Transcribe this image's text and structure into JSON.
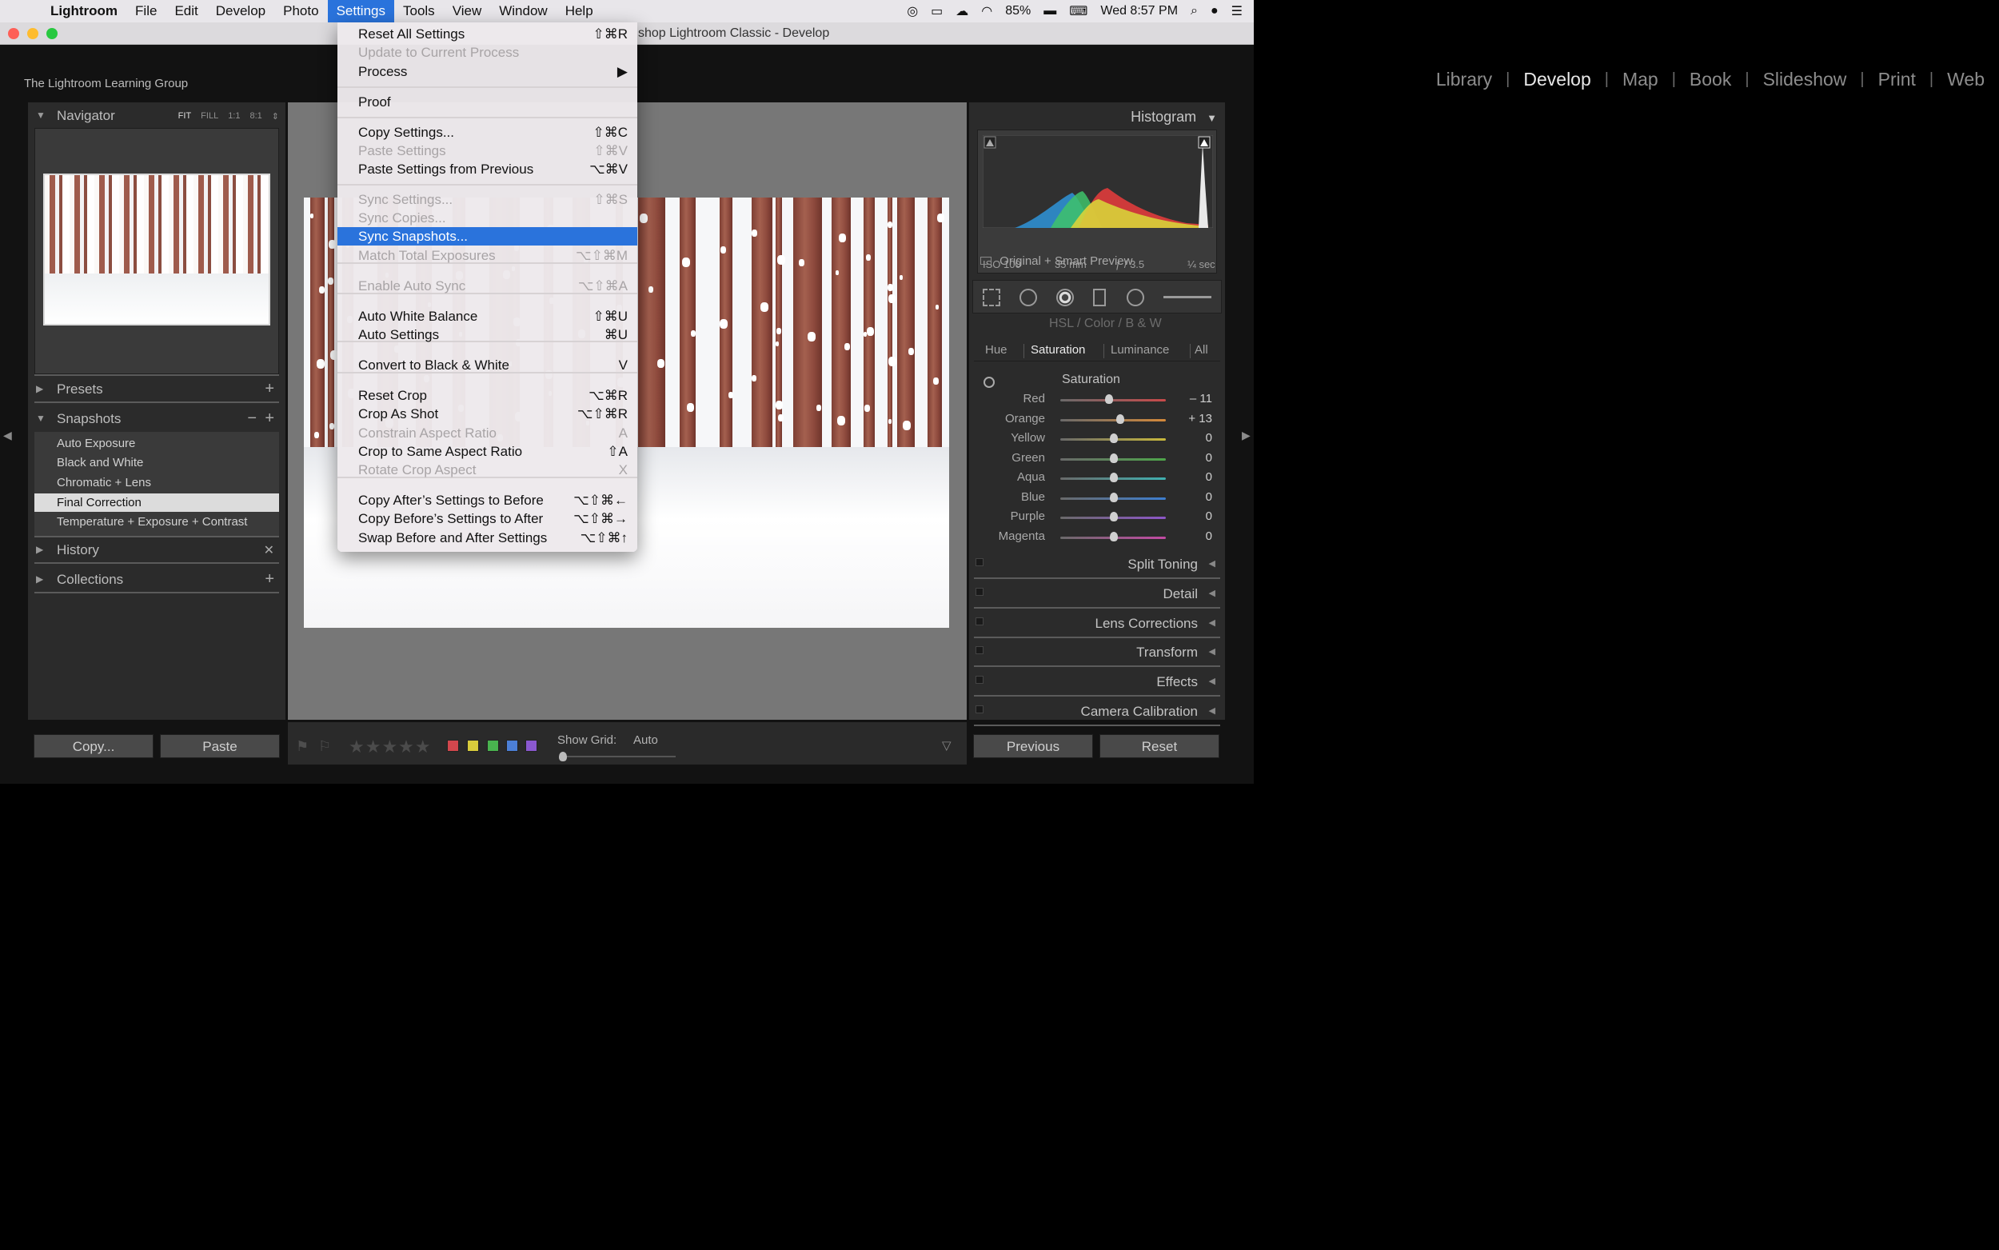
{
  "menubar": {
    "apple": "",
    "items": [
      "Lightroom",
      "File",
      "Edit",
      "Develop",
      "Photo",
      "Settings",
      "Tools",
      "View",
      "Window",
      "Help"
    ],
    "battery": "85%",
    "clock": "Wed 8:57 PM"
  },
  "window": {
    "title": "shop Lightroom Classic - Develop"
  },
  "identity": "The Lightroom Learning Group",
  "modules": [
    "Library",
    "Develop",
    "Map",
    "Book",
    "Slideshow",
    "Print",
    "Web"
  ],
  "left": {
    "navigator": {
      "title": "Navigator",
      "zoom": [
        "FIT",
        "FILL",
        "1:1",
        "8:1"
      ]
    },
    "presets": {
      "title": "Presets"
    },
    "snapshots": {
      "title": "Snapshots",
      "items": [
        "Auto Exposure",
        "Black and White",
        "Chromatic + Lens",
        "Final Correction",
        "Temperature + Exposure + Contrast"
      ],
      "selected_index": 3
    },
    "history": {
      "title": "History"
    },
    "collections": {
      "title": "Collections"
    },
    "copy_label": "Copy...",
    "paste_label": "Paste"
  },
  "toolbar": {
    "show_grid_label": "Show Grid:",
    "grid_value": "Auto"
  },
  "right": {
    "histogram": {
      "title": "Histogram",
      "iso": "ISO 100",
      "focal": "35 mm",
      "aperture": "ƒ / 3.5",
      "shutter": "¼ sec"
    },
    "preview": "Original + Smart Preview",
    "hsl_header": "HSL  /  Color  /  B & W",
    "tabs": [
      "Hue",
      "Saturation",
      "Luminance",
      "All"
    ],
    "saturation_title": "Saturation",
    "colors": [
      {
        "name": "Red",
        "value": "– 11",
        "color": "#c84a4a"
      },
      {
        "name": "Orange",
        "value": "+ 13",
        "color": "#d4893a"
      },
      {
        "name": "Yellow",
        "value": "0",
        "color": "#c9b93c"
      },
      {
        "name": "Green",
        "value": "0",
        "color": "#4ea64a"
      },
      {
        "name": "Aqua",
        "value": "0",
        "color": "#3fb0b0"
      },
      {
        "name": "Blue",
        "value": "0",
        "color": "#3d7ed0"
      },
      {
        "name": "Purple",
        "value": "0",
        "color": "#8c56c8"
      },
      {
        "name": "Magenta",
        "value": "0",
        "color": "#c34aa4"
      }
    ],
    "sections": [
      "Split Toning",
      "Detail",
      "Lens Corrections",
      "Transform",
      "Effects",
      "Camera Calibration"
    ],
    "previous_label": "Previous",
    "reset_label": "Reset"
  },
  "settings_menu": [
    {
      "label": "Reset All Settings",
      "key": "⇧⌘R"
    },
    {
      "label": "Update to Current Process",
      "key": "",
      "disabled": true
    },
    {
      "label": "Process",
      "key": "▶"
    },
    {
      "label": "Proof",
      "key": ""
    },
    {
      "label": "Copy Settings...",
      "key": "⇧⌘C"
    },
    {
      "label": "Paste Settings",
      "key": "⇧⌘V",
      "disabled": true
    },
    {
      "label": "Paste Settings from Previous",
      "key": "⌥⌘V"
    },
    {
      "label": "Sync Settings...",
      "key": "⇧⌘S",
      "disabled": true
    },
    {
      "label": "Sync Copies...",
      "key": "",
      "disabled": true
    },
    {
      "label": "Sync Snapshots...",
      "key": "",
      "highlighted": true
    },
    {
      "label": "Match Total Exposures",
      "key": "⌥⇧⌘M",
      "disabled": true
    },
    {
      "label": "Enable Auto Sync",
      "key": "⌥⇧⌘A",
      "disabled": true
    },
    {
      "label": "Auto White Balance",
      "key": "⇧⌘U"
    },
    {
      "label": "Auto Settings",
      "key": "⌘U"
    },
    {
      "label": "Convert to Black & White",
      "key": "V"
    },
    {
      "label": "Reset Crop",
      "key": "⌥⌘R"
    },
    {
      "label": "Crop As Shot",
      "key": "⌥⇧⌘R"
    },
    {
      "label": "Constrain Aspect Ratio",
      "key": "A",
      "disabled": true
    },
    {
      "label": "Crop to Same Aspect Ratio",
      "key": "⇧A"
    },
    {
      "label": "Rotate Crop Aspect",
      "key": "X",
      "disabled": true
    },
    {
      "label": "Copy After’s Settings to Before",
      "key": "⌥⇧⌘←"
    },
    {
      "label": "Copy Before’s Settings to After",
      "key": "⌥⇧⌘→"
    },
    {
      "label": "Swap Before and After Settings",
      "key": "⌥⇧⌘↑"
    }
  ]
}
